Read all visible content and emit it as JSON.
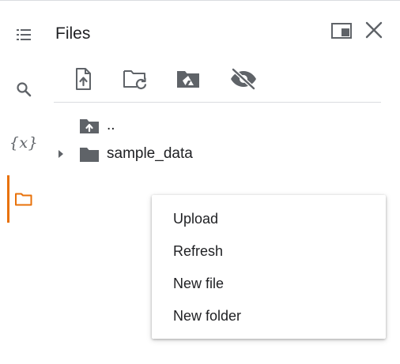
{
  "panel": {
    "title": "Files"
  },
  "sidebar": {
    "items": [
      {
        "name": "table-of-contents",
        "icon": "toc-icon"
      },
      {
        "name": "find",
        "icon": "search-icon"
      },
      {
        "name": "variables",
        "icon": "variables-icon",
        "label": "{x}"
      },
      {
        "name": "files",
        "icon": "folder-icon",
        "active": true
      }
    ],
    "active_color": "#e8710a"
  },
  "header": {
    "buttons": [
      {
        "icon": "open-in-tab-icon"
      },
      {
        "icon": "close-icon"
      }
    ]
  },
  "toolbar": {
    "buttons": [
      {
        "icon": "upload-file-icon"
      },
      {
        "icon": "refresh-folder-icon"
      },
      {
        "icon": "mount-drive-icon"
      },
      {
        "icon": "hide-hidden-files-icon"
      }
    ]
  },
  "tree": {
    "parent_label": "..",
    "folder_label": "sample_data"
  },
  "context_menu": {
    "items": [
      {
        "label": "Upload"
      },
      {
        "label": "Refresh"
      },
      {
        "label": "New file"
      },
      {
        "label": "New folder"
      }
    ]
  }
}
